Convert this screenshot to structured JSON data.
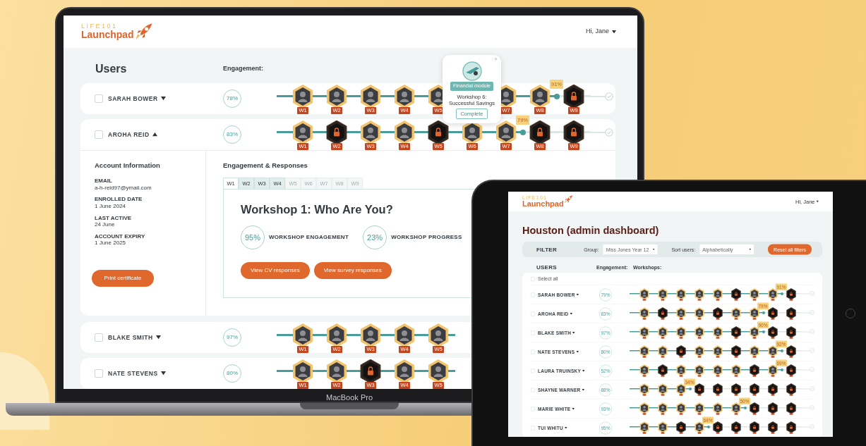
{
  "laptop": {
    "logo": {
      "line1": "LIFE101",
      "line2": "Launchpad"
    },
    "user_menu": "Hi, Jane",
    "users_heading": "Users",
    "engagement_heading": "Engagement:",
    "users": [
      {
        "name": "SARAH BOWER",
        "checked": false,
        "expanded": false,
        "engagement": "78%",
        "track": [
          {
            "kind": "badge",
            "label": "W1",
            "unlocked": true
          },
          {
            "kind": "badge",
            "label": "W2",
            "unlocked": true
          },
          {
            "kind": "badge",
            "label": "W3",
            "unlocked": true
          },
          {
            "kind": "badge",
            "label": "W4",
            "unlocked": true
          },
          {
            "kind": "badge",
            "label": "W5",
            "unlocked": true
          },
          {
            "kind": "covered"
          },
          {
            "kind": "badge",
            "label": "W7",
            "unlocked": true
          },
          {
            "kind": "badge",
            "label": "W8",
            "unlocked": true
          },
          {
            "kind": "marker",
            "label": "91%"
          },
          {
            "kind": "badge",
            "label": "W9",
            "unlocked": false
          },
          {
            "kind": "finish"
          }
        ]
      },
      {
        "name": "AROHA REID",
        "checked": false,
        "expanded": true,
        "engagement": "83%",
        "track": [
          {
            "kind": "badge",
            "label": "W1",
            "unlocked": true
          },
          {
            "kind": "badge",
            "label": "W2",
            "unlocked": false
          },
          {
            "kind": "badge",
            "label": "W3",
            "unlocked": true
          },
          {
            "kind": "badge",
            "label": "W4",
            "unlocked": true
          },
          {
            "kind": "badge",
            "label": "W5",
            "unlocked": false
          },
          {
            "kind": "badge",
            "label": "W6",
            "unlocked": true
          },
          {
            "kind": "badge",
            "label": "W7",
            "unlocked": true
          },
          {
            "kind": "marker",
            "label": "79%"
          },
          {
            "kind": "badge",
            "label": "W8",
            "unlocked": false
          },
          {
            "kind": "badge",
            "label": "W9",
            "unlocked": false
          },
          {
            "kind": "finish"
          }
        ],
        "detail": {
          "account_title": "Account Information",
          "fields": [
            {
              "label": "EMAIL",
              "value": "a-h-reid97@ymail.com"
            },
            {
              "label": "ENROLLED DATE",
              "value": "1 June 2024"
            },
            {
              "label": "LAST ACTIVE",
              "value": "24 June"
            },
            {
              "label": "ACCOUNT EXPIRY",
              "value": "1 June 2025"
            }
          ],
          "print_button": "Print certificate",
          "responses_title": "Engagement & Responses",
          "tabs": [
            {
              "label": "W1",
              "selected": true,
              "disabled": false
            },
            {
              "label": "W2",
              "selected": false,
              "disabled": false
            },
            {
              "label": "W3",
              "selected": false,
              "disabled": false
            },
            {
              "label": "W4",
              "selected": false,
              "disabled": false
            },
            {
              "label": "W5",
              "selected": false,
              "disabled": true
            },
            {
              "label": "W6",
              "selected": false,
              "disabled": true
            },
            {
              "label": "W7",
              "selected": false,
              "disabled": true
            },
            {
              "label": "W8",
              "selected": false,
              "disabled": true
            },
            {
              "label": "W9",
              "selected": false,
              "disabled": true
            }
          ],
          "workshop_title": "Workshop 1: Who Are You?",
          "stats": [
            {
              "text": "95%",
              "label": "WORKSHOP ENGAGEMENT"
            },
            {
              "text": "23%",
              "label": "WORKSHOP PROGRESS"
            }
          ],
          "buttons": [
            "View CV responses",
            "View survey responses"
          ]
        }
      },
      {
        "name": "BLAKE SMITH",
        "checked": false,
        "expanded": false,
        "engagement": "97%",
        "track": [
          {
            "kind": "badge",
            "label": "W1",
            "unlocked": true
          },
          {
            "kind": "badge",
            "label": "W2",
            "unlocked": true
          },
          {
            "kind": "badge",
            "label": "W3",
            "unlocked": true
          },
          {
            "kind": "badge",
            "label": "W4",
            "unlocked": true
          },
          {
            "kind": "badge",
            "label": "W5",
            "unlocked": true
          }
        ]
      },
      {
        "name": "NATE STEVENS",
        "checked": false,
        "expanded": false,
        "engagement": "80%",
        "track": [
          {
            "kind": "badge",
            "label": "W1",
            "unlocked": true
          },
          {
            "kind": "badge",
            "label": "W2",
            "unlocked": true
          },
          {
            "kind": "badge",
            "label": "W3",
            "unlocked": false
          },
          {
            "kind": "badge",
            "label": "W4",
            "unlocked": true
          },
          {
            "kind": "badge",
            "label": "W5",
            "unlocked": true
          }
        ]
      }
    ],
    "popup": {
      "close": "×",
      "tag": "Financial module",
      "title": "Workshop 6: Successful Savings",
      "status": "Complete"
    },
    "device_label": "MacBook Pro"
  },
  "tablet": {
    "logo": {
      "line1": "LIFE101",
      "line2": "Launchpad"
    },
    "user_menu": "Hi, Jane",
    "title": "Houston (admin dashboard)",
    "filter": {
      "label": "FILTER",
      "group_label": "Group:",
      "group_value": "Miss Jones Year 12",
      "sort_label": "Sort users:",
      "sort_value": "Alphabetically",
      "reset_button": "Reset all filters"
    },
    "users_heading": "USERS",
    "engagement_heading": "Engagement:",
    "workshops_heading": "Workshops:",
    "select_all": "Select all",
    "select_all_checked": false,
    "users": [
      {
        "name": "SARAH BOWER",
        "checked": false,
        "expanded": false,
        "engagement": "79%",
        "track": [
          {
            "kind": "badge",
            "unlocked": true
          },
          {
            "kind": "badge",
            "unlocked": true
          },
          {
            "kind": "badge",
            "unlocked": true
          },
          {
            "kind": "badge",
            "unlocked": true
          },
          {
            "kind": "badge",
            "unlocked": true
          },
          {
            "kind": "badge",
            "unlocked": false
          },
          {
            "kind": "badge",
            "unlocked": true
          },
          {
            "kind": "badge",
            "unlocked": true
          },
          {
            "kind": "marker",
            "label": "91%"
          },
          {
            "kind": "badge",
            "unlocked": false
          },
          {
            "kind": "finish"
          }
        ]
      },
      {
        "name": "AROHA REID",
        "checked": false,
        "expanded": false,
        "engagement": "83%",
        "track": [
          {
            "kind": "badge",
            "unlocked": true
          },
          {
            "kind": "badge",
            "unlocked": false
          },
          {
            "kind": "badge",
            "unlocked": true
          },
          {
            "kind": "badge",
            "unlocked": true
          },
          {
            "kind": "badge",
            "unlocked": false
          },
          {
            "kind": "badge",
            "unlocked": true
          },
          {
            "kind": "badge",
            "unlocked": true
          },
          {
            "kind": "marker",
            "label": "79%"
          },
          {
            "kind": "badge",
            "unlocked": false
          },
          {
            "kind": "badge",
            "unlocked": false
          },
          {
            "kind": "finish"
          }
        ]
      },
      {
        "name": "BLAKE SMITH",
        "checked": false,
        "expanded": false,
        "engagement": "97%",
        "track": [
          {
            "kind": "badge",
            "unlocked": true
          },
          {
            "kind": "badge",
            "unlocked": true
          },
          {
            "kind": "badge",
            "unlocked": true
          },
          {
            "kind": "badge",
            "unlocked": true
          },
          {
            "kind": "badge",
            "unlocked": true
          },
          {
            "kind": "badge",
            "unlocked": false
          },
          {
            "kind": "badge",
            "unlocked": true
          },
          {
            "kind": "marker",
            "label": "90%"
          },
          {
            "kind": "badge",
            "unlocked": false
          },
          {
            "kind": "badge",
            "unlocked": false
          },
          {
            "kind": "finish"
          }
        ]
      },
      {
        "name": "NATE STEVENS",
        "checked": false,
        "expanded": false,
        "engagement": "80%",
        "track": [
          {
            "kind": "badge",
            "unlocked": true
          },
          {
            "kind": "badge",
            "unlocked": true
          },
          {
            "kind": "badge",
            "unlocked": false
          },
          {
            "kind": "badge",
            "unlocked": true
          },
          {
            "kind": "badge",
            "unlocked": true
          },
          {
            "kind": "badge",
            "unlocked": false
          },
          {
            "kind": "badge",
            "unlocked": true
          },
          {
            "kind": "badge",
            "unlocked": true
          },
          {
            "kind": "marker",
            "label": "92%"
          },
          {
            "kind": "badge",
            "unlocked": false
          },
          {
            "kind": "finish"
          }
        ]
      },
      {
        "name": "LAURA TRUINSKY",
        "checked": false,
        "expanded": false,
        "engagement": "52%",
        "track": [
          {
            "kind": "badge",
            "unlocked": true
          },
          {
            "kind": "badge",
            "unlocked": false
          },
          {
            "kind": "badge",
            "unlocked": true
          },
          {
            "kind": "badge",
            "unlocked": true
          },
          {
            "kind": "badge",
            "unlocked": true
          },
          {
            "kind": "badge",
            "unlocked": true
          },
          {
            "kind": "badge",
            "unlocked": false
          },
          {
            "kind": "badge",
            "unlocked": true
          },
          {
            "kind": "marker",
            "label": "69%"
          },
          {
            "kind": "badge",
            "unlocked": false
          },
          {
            "kind": "finish"
          }
        ]
      },
      {
        "name": "SHAYNE WARNER",
        "checked": false,
        "expanded": false,
        "engagement": "88%",
        "track": [
          {
            "kind": "badge",
            "unlocked": true
          },
          {
            "kind": "badge",
            "unlocked": true
          },
          {
            "kind": "badge",
            "unlocked": true
          },
          {
            "kind": "marker",
            "label": "34%"
          },
          {
            "kind": "badge",
            "unlocked": false
          },
          {
            "kind": "badge",
            "unlocked": false
          },
          {
            "kind": "badge",
            "unlocked": false
          },
          {
            "kind": "badge",
            "unlocked": false
          },
          {
            "kind": "badge",
            "unlocked": false
          },
          {
            "kind": "badge",
            "unlocked": false
          },
          {
            "kind": "finish"
          }
        ]
      },
      {
        "name": "MARIE WHITE",
        "checked": false,
        "expanded": false,
        "engagement": "93%",
        "track": [
          {
            "kind": "badge",
            "unlocked": true
          },
          {
            "kind": "badge",
            "unlocked": true
          },
          {
            "kind": "badge",
            "unlocked": true
          },
          {
            "kind": "badge",
            "unlocked": true
          },
          {
            "kind": "badge",
            "unlocked": true
          },
          {
            "kind": "badge",
            "unlocked": true
          },
          {
            "kind": "marker",
            "label": "50%"
          },
          {
            "kind": "badge",
            "unlocked": false
          },
          {
            "kind": "badge",
            "unlocked": false
          },
          {
            "kind": "badge",
            "unlocked": false
          },
          {
            "kind": "finish"
          }
        ]
      },
      {
        "name": "TUI WHITU",
        "checked": false,
        "expanded": false,
        "engagement": "95%",
        "track": [
          {
            "kind": "badge",
            "unlocked": true
          },
          {
            "kind": "badge",
            "unlocked": true
          },
          {
            "kind": "badge",
            "unlocked": false
          },
          {
            "kind": "badge",
            "unlocked": true
          },
          {
            "kind": "marker",
            "label": "64%"
          },
          {
            "kind": "badge",
            "unlocked": false
          },
          {
            "kind": "badge",
            "unlocked": false
          },
          {
            "kind": "badge",
            "unlocked": false
          },
          {
            "kind": "badge",
            "unlocked": false
          },
          {
            "kind": "badge",
            "unlocked": false
          },
          {
            "kind": "finish"
          }
        ]
      }
    ]
  }
}
